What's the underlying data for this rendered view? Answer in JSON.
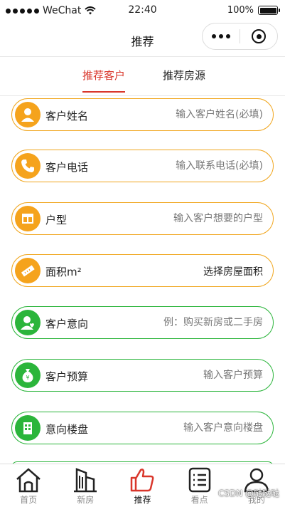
{
  "status_bar": {
    "carrier": "WeChat",
    "time": "22:40",
    "battery": "100%",
    "battery_level": 1.0
  },
  "nav": {
    "title": "推荐"
  },
  "tabs": [
    {
      "label": "推荐客户",
      "active": true
    },
    {
      "label": "推荐房源",
      "active": false
    }
  ],
  "form": {
    "rows": [
      {
        "label": "客户姓名",
        "placeholder": "输入客户姓名(必填)",
        "icon": "person-icon",
        "color": "#f5a31c"
      },
      {
        "label": "客户电话",
        "placeholder": "输入联系电话(必填)",
        "icon": "phone-icon",
        "color": "#f5a31c"
      },
      {
        "label": "户型",
        "placeholder": "输入客户想要的户型",
        "icon": "floorplan-icon",
        "color": "#f5a31c"
      },
      {
        "label": "面积m²",
        "value": "选择房屋面积",
        "icon": "ruler-icon",
        "color": "#f5a31c"
      },
      {
        "label": "客户意向",
        "placeholder": "例：购买新房或二手房",
        "icon": "user-heart-icon",
        "color": "#2bb53b"
      },
      {
        "label": "客户预算",
        "placeholder": "输入客户预算",
        "icon": "money-bag-icon",
        "color": "#2bb53b"
      },
      {
        "label": "意向楼盘",
        "placeholder": "输入客户意向楼盘",
        "icon": "building-icon",
        "color": "#2bb53b"
      }
    ]
  },
  "tabbar": [
    {
      "label": "首页",
      "icon": "home-icon"
    },
    {
      "label": "新房",
      "icon": "building-icon"
    },
    {
      "label": "推荐",
      "icon": "thumbs-up-icon",
      "active": true
    },
    {
      "label": "看点",
      "icon": "document-list-icon"
    },
    {
      "label": "我的",
      "icon": "user-icon"
    }
  ],
  "watermark": "CSDN @哒哒哒"
}
